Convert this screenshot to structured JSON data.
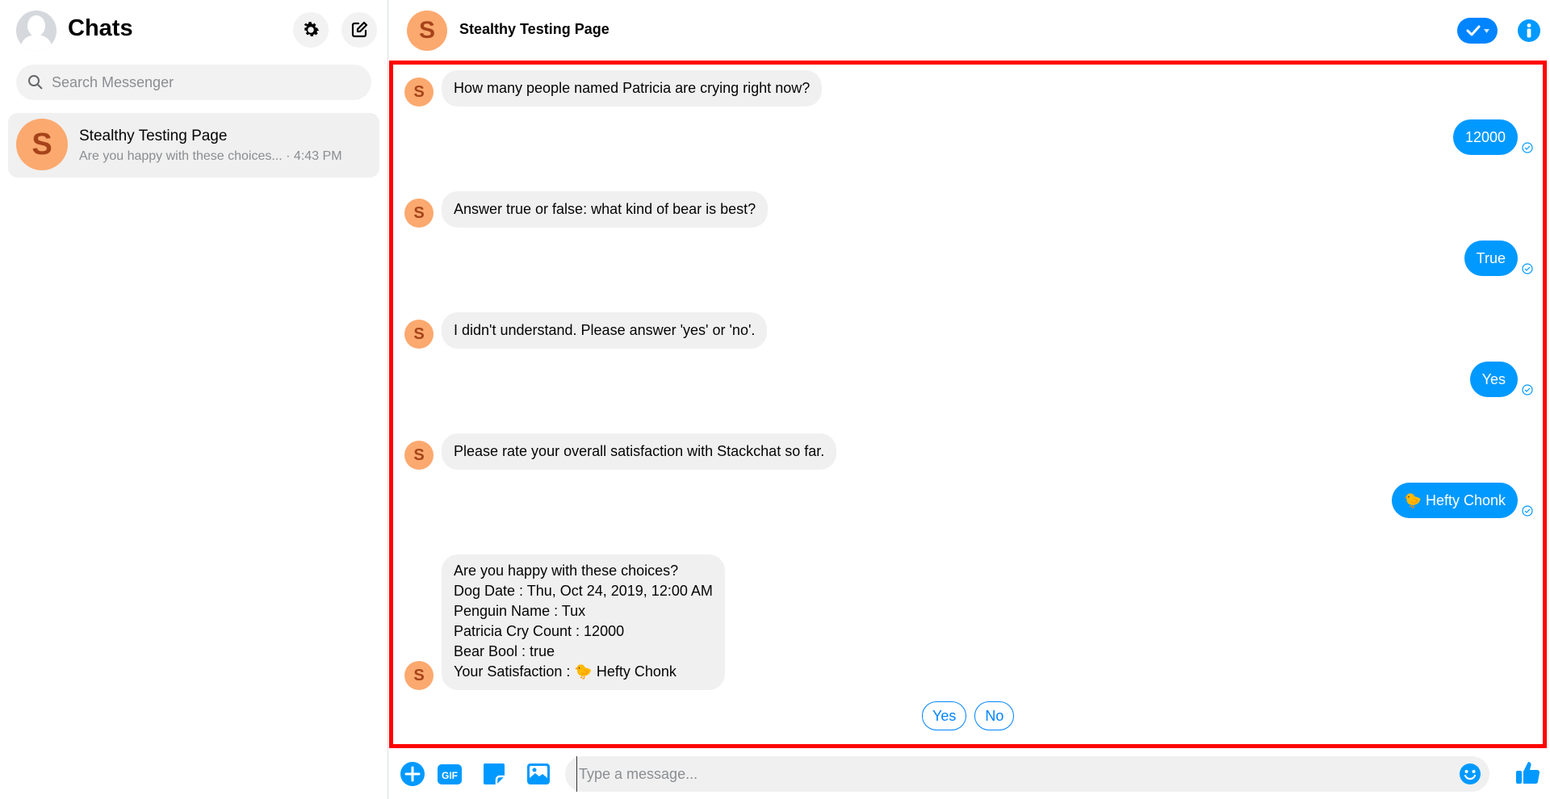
{
  "sidebar": {
    "title": "Chats",
    "search_placeholder": "Search Messenger",
    "conversations": [
      {
        "avatar_letter": "S",
        "name": "Stealthy Testing Page",
        "preview": "Are you happy with these choices...",
        "time": "· 4:43 PM"
      }
    ]
  },
  "header": {
    "avatar_letter": "S",
    "title": "Stealthy Testing Page"
  },
  "messages": [
    {
      "from": "bot",
      "avatar_letter": "S",
      "text": "How many people named Patricia are crying right now?"
    },
    {
      "from": "me",
      "text": "12000"
    },
    {
      "from": "bot",
      "avatar_letter": "S",
      "text": "Answer true or false: what kind of bear is best?"
    },
    {
      "from": "me",
      "text": "True"
    },
    {
      "from": "bot",
      "avatar_letter": "S",
      "text": "I didn't understand. Please answer 'yes' or 'no'."
    },
    {
      "from": "me",
      "text": "Yes"
    },
    {
      "from": "bot",
      "avatar_letter": "S",
      "text": "Please rate your overall satisfaction with Stackchat so far."
    },
    {
      "from": "me",
      "text": "🐤 Hefty Chonk"
    },
    {
      "from": "bot",
      "avatar_letter": "S",
      "lines": [
        "Are you happy with these choices?",
        "Dog Date : Thu, Oct 24, 2019, 12:00 AM",
        "Penguin Name : Tux",
        "Patricia Cry Count : 12000",
        "Bear Bool : true",
        "Your Satisfaction : 🐤 Hefty Chonk"
      ]
    }
  ],
  "quick_replies": [
    "Yes",
    "No"
  ],
  "composer": {
    "placeholder": "Type a message..."
  },
  "colors": {
    "accent": "#0084ff",
    "outgoing_bubble": "#0099ff",
    "avatar_bg": "#fba96f",
    "avatar_fg": "#a6431a",
    "highlight_border": "#ff0000"
  }
}
